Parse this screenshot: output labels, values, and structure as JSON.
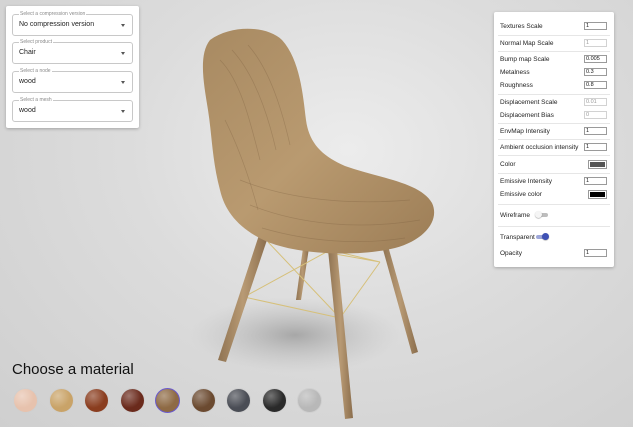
{
  "selectors": [
    {
      "label": "Select a compression version",
      "value": "No compression version",
      "has_caret": true
    },
    {
      "label": "Select product",
      "value": "Chair",
      "has_caret": true
    },
    {
      "label": "Select a node",
      "value": "wood",
      "has_caret": true
    },
    {
      "label": "Select a mesh",
      "value": "wood",
      "has_caret": true
    }
  ],
  "properties": {
    "textures_scale": {
      "label": "Textures Scale",
      "value": "1"
    },
    "normal_map_scale": {
      "label": "Normal Map Scale",
      "value": "1"
    },
    "bump_map_scale": {
      "label": "Bump map Scale",
      "value": "0.005"
    },
    "metalness": {
      "label": "Metalness",
      "value": "0.3"
    },
    "roughness": {
      "label": "Roughness",
      "value": "0.8"
    },
    "displacement_scale": {
      "label": "Displacement Scale",
      "value": "0.01"
    },
    "displacement_bias": {
      "label": "Displacement Bias",
      "value": "0"
    },
    "envmap_intensity": {
      "label": "EnvMap Intensity",
      "value": "1"
    },
    "ao_intensity": {
      "label": "Ambient occlusion intensity",
      "value": "1"
    },
    "color": {
      "label": "Color",
      "swatch": "#555555"
    },
    "emissive_intensity": {
      "label": "Emissive Intensity",
      "value": "1"
    },
    "emissive_color": {
      "label": "Emissive color",
      "swatch": "#000000"
    },
    "wireframe": {
      "label": "Wireframe",
      "on": false
    },
    "transparent": {
      "label": "Transparent",
      "on": true
    },
    "opacity": {
      "label": "Opacity",
      "value": "1"
    }
  },
  "materials": {
    "title": "Choose a material",
    "items": [
      {
        "name": "pale-peach",
        "color": "#e7c2ad",
        "selected": false
      },
      {
        "name": "light-oak",
        "color": "#c9a368",
        "selected": false
      },
      {
        "name": "mahogany",
        "color": "#8a3d1f",
        "selected": false
      },
      {
        "name": "dark-cherry",
        "color": "#6a2a1c",
        "selected": false
      },
      {
        "name": "walnut",
        "color": "#8e6a44",
        "selected": true
      },
      {
        "name": "dark-wood",
        "color": "#6b4a30",
        "selected": false
      },
      {
        "name": "steel",
        "color": "#4a4d55",
        "selected": false
      },
      {
        "name": "black-metal",
        "color": "#2a2a2a",
        "selected": false
      },
      {
        "name": "chrome",
        "color": "#b8b8b8",
        "selected": false
      }
    ]
  },
  "colors": {
    "accent": "#3f51b5",
    "toggle_off": "#9e9e9e"
  }
}
